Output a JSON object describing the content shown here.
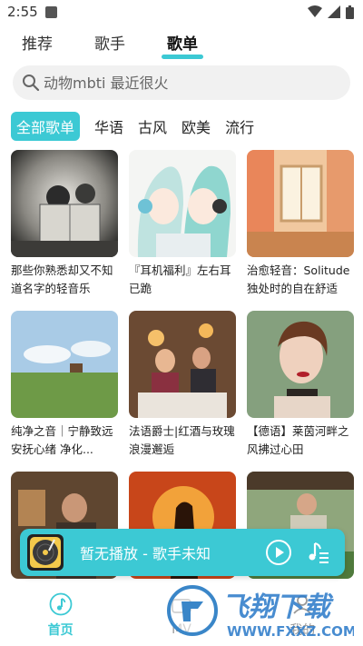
{
  "status": {
    "time": "2:55"
  },
  "tabs": [
    {
      "label": "推荐"
    },
    {
      "label": "歌手"
    },
    {
      "label": "歌单"
    }
  ],
  "search": {
    "placeholder": "动物mbti 最近很火"
  },
  "categories": [
    {
      "label": "全部歌单"
    },
    {
      "label": "华语"
    },
    {
      "label": "古风"
    },
    {
      "label": "欧美"
    },
    {
      "label": "流行"
    }
  ],
  "playlists": [
    {
      "title": "那些你熟悉却又不知道名字的轻音乐"
    },
    {
      "title": "『耳机福利』左右耳已跪"
    },
    {
      "title": "治愈轻音：Solitude独处时的自在舒适"
    },
    {
      "title": "纯净之音｜宁静致远 安抚心绪 净化..."
    },
    {
      "title": "法语爵士|红酒与玫瑰浪漫邂逅"
    },
    {
      "title": "【德语】莱茵河畔之风拂过心田"
    },
    {
      "title": ""
    },
    {
      "title": ""
    },
    {
      "title": ""
    }
  ],
  "player": {
    "text": "暂无播放 - 歌手未知"
  },
  "bottom_nav": [
    {
      "label": "首页"
    },
    {
      "label": "MV"
    },
    {
      "label": "我的"
    }
  ],
  "watermark": {
    "text": "飞翔下载",
    "url": "WWW.FXXZ.COM"
  },
  "colors": {
    "accent": "#3cc9d4"
  }
}
